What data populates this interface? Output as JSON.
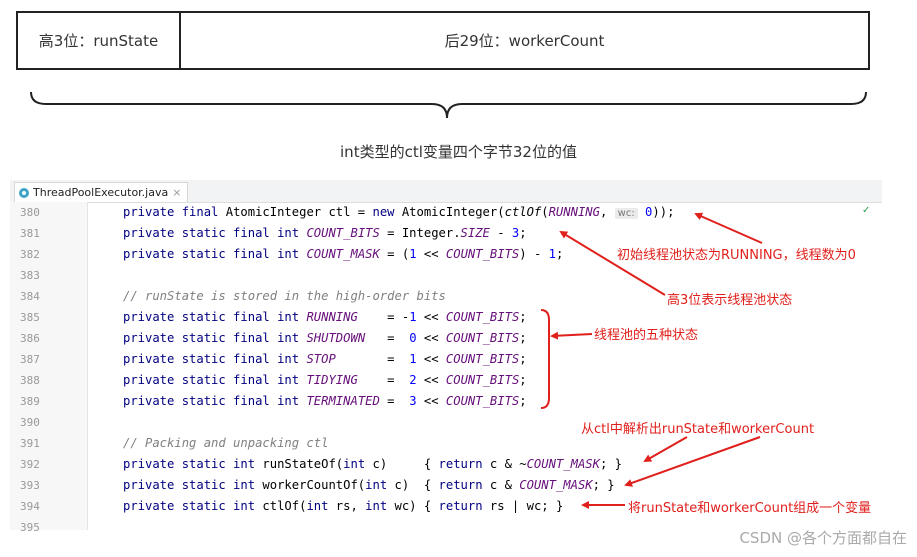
{
  "bits_diagram": {
    "high_label": "高3位：runState",
    "low_label": "后29位：workerCount",
    "caption": "int类型的ctl变量四个字节32位的值"
  },
  "editor": {
    "tab": {
      "filename": "ThreadPoolExecutor.java",
      "close_glyph": "×",
      "icon": "java-class-icon"
    },
    "lines": [
      {
        "no": "380",
        "code": "private final AtomicInteger ctl = new AtomicInteger(ctlOf(RUNNING, wc: 0));"
      },
      {
        "no": "381",
        "code": "private static final int COUNT_BITS = Integer.SIZE - 3;"
      },
      {
        "no": "382",
        "code": "private static final int COUNT_MASK = (1 << COUNT_BITS) - 1;"
      },
      {
        "no": "383",
        "code": ""
      },
      {
        "no": "384",
        "code": "// runState is stored in the high-order bits"
      },
      {
        "no": "385",
        "code": "private static final int RUNNING    = -1 << COUNT_BITS;"
      },
      {
        "no": "386",
        "code": "private static final int SHUTDOWN   =  0 << COUNT_BITS;"
      },
      {
        "no": "387",
        "code": "private static final int STOP       =  1 << COUNT_BITS;"
      },
      {
        "no": "388",
        "code": "private static final int TIDYING    =  2 << COUNT_BITS;"
      },
      {
        "no": "389",
        "code": "private static final int TERMINATED =  3 << COUNT_BITS;"
      },
      {
        "no": "390",
        "code": ""
      },
      {
        "no": "391",
        "code": "// Packing and unpacking ctl"
      },
      {
        "no": "392",
        "code": "private static int runStateOf(int c)     { return c & ~COUNT_MASK; }"
      },
      {
        "no": "393",
        "code": "private static int workerCountOf(int c)  { return c & COUNT_MASK; }"
      },
      {
        "no": "394",
        "code": "private static int ctlOf(int rs, int wc) { return rs | wc; }"
      },
      {
        "no": "395",
        "code": ""
      }
    ]
  },
  "annotations": {
    "initial_state": "初始线程池状态为RUNNING，线程数为0",
    "high3_state": "高3位表示线程池状态",
    "five_states": "线程池的五种状态",
    "parse_ctl": "从ctl中解析出runState和workerCount",
    "compose_ctl": "将runState和workerCount组成一个变量"
  },
  "watermark": "CSDN @各个方面都自在",
  "colors": {
    "annotation": "#e0201c",
    "keyword": "#000080",
    "constant": "#660e7a",
    "comment": "#808080",
    "number": "#0000ff"
  }
}
